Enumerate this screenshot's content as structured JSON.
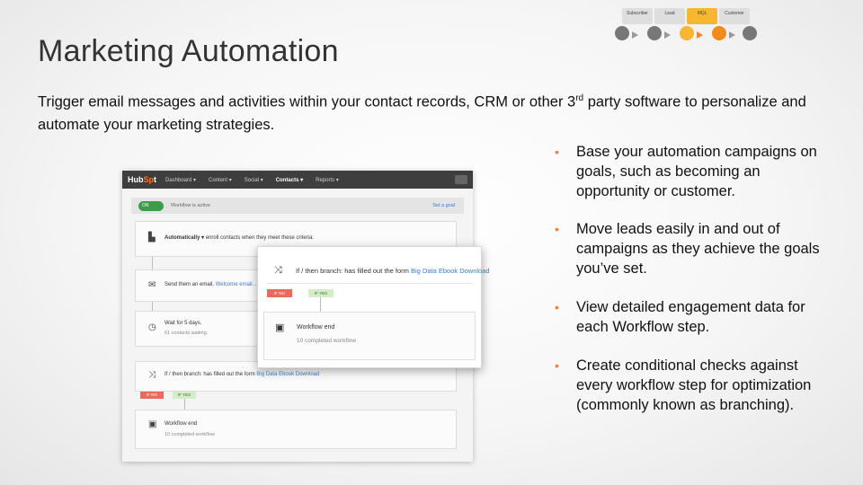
{
  "slide": {
    "title": "Marketing Automation",
    "subtitle_pre": "Trigger email messages and activities within your contact records, CRM or other 3",
    "subtitle_sup": "rd",
    "subtitle_post": " party software to personalize and automate your marketing strategies."
  },
  "stages": {
    "labels": [
      "Subscriber",
      "Lead",
      "MQL",
      "Customer"
    ],
    "colors": {
      "box": "#dedede",
      "highlight": "#f7b731",
      "circle": "#777777",
      "active_circle": "#f08a1d"
    }
  },
  "app": {
    "logo_pre": "Hub",
    "logo_highlight": "Sp",
    "logo_post": "t",
    "nav": [
      "Dashboard ▾",
      "Content ▾",
      "Social ▾",
      "Contacts ▾",
      "Reports ▾"
    ],
    "toggle_label": "ON",
    "status_text": "Workflow is active",
    "status_link": "Set a goal",
    "trigger_bold": "Automatically ▾",
    "trigger_text": "enroll contacts when they meet these criteria:",
    "email_text": "Send them an email,",
    "email_link": "Welcome email...",
    "wait_text": "Wait for 5 days.",
    "wait_sub": "61 contacts waiting.",
    "branch_text": "If / then branch: has filled out the form",
    "branch_link": "Big Data Ebook Download",
    "tag_no": "IF NO",
    "tag_yes": "IF YES",
    "end_text": "Workflow end",
    "end_sub": "10 completed workflow"
  },
  "bullets": [
    "Base your automation campaigns on goals, such as becoming an opportunity or customer.",
    "Move leads easily in and out of campaigns as they achieve the goals you’ve set.",
    "View detailed engagement data for each Workflow step.",
    "Create conditional checks against every workflow step for optimization (commonly known as branching)."
  ],
  "bullet_marker": "•"
}
